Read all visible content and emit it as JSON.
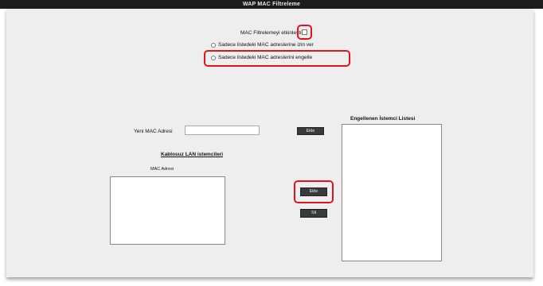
{
  "window": {
    "title": "WAP MAC Filtreleme"
  },
  "filter": {
    "enable_label": "MAC Filtrelemeyi etkinleştir",
    "option_allow_label": "Sadece listedeki MAC adreslerine izin ver",
    "option_deny_label": "Sadece listedeki MAC adreslerini engelle"
  },
  "new_mac": {
    "label": "Yeni MAC Adresi",
    "value": "",
    "add_button": "Ekle"
  },
  "wireless_devices": {
    "title": "Kablosuz LAN istemcileri",
    "column_header": "MAC Adresi"
  },
  "actions": {
    "add_selected": "Ekle",
    "remove": "Sil"
  },
  "blocked_list": {
    "title": "Engellenen İstemci Listesi"
  },
  "colors": {
    "highlight": "#e0141c",
    "panel_bg": "#eeeeee",
    "button_bg": "#3a3a3a"
  }
}
